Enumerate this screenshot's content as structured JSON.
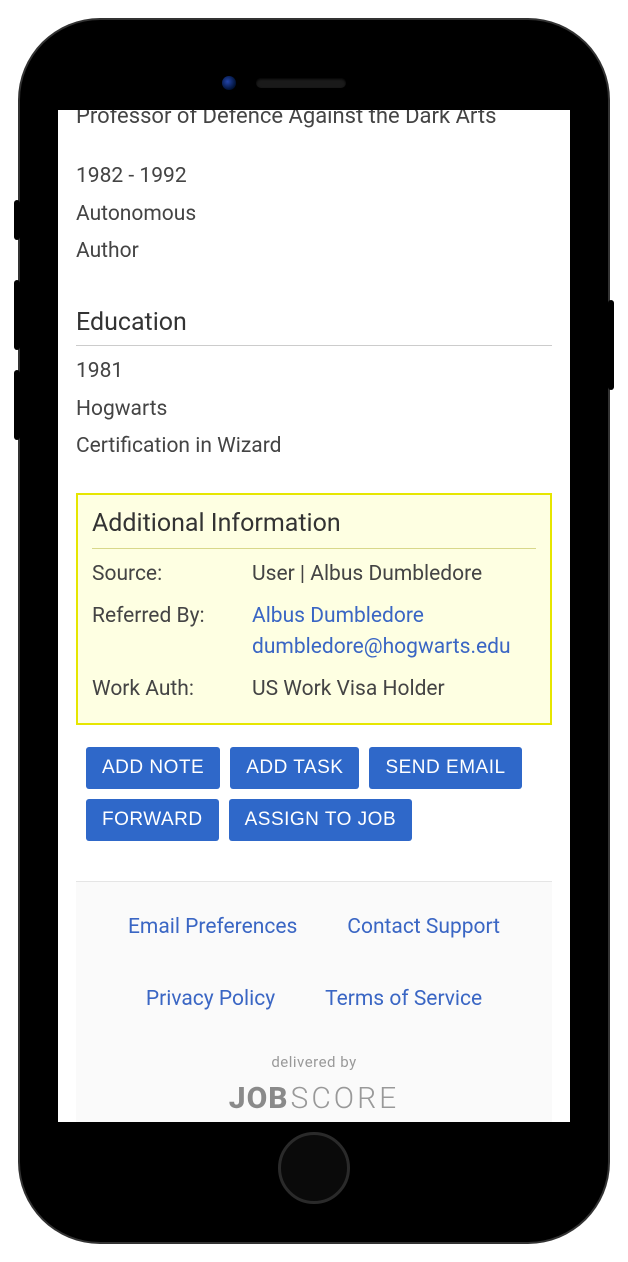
{
  "experience": {
    "title_cut": "Professor of Defence Against the Dark Arts",
    "dates": "1982 - 1992",
    "company": "Autonomous",
    "role": "Author"
  },
  "education": {
    "heading": "Education",
    "year": "1981",
    "school": "Hogwarts",
    "degree": "Certification in Wizard"
  },
  "additional": {
    "heading": "Additional Information",
    "source_label": "Source:",
    "source_value": "User | Albus Dumbledore",
    "referred_label": "Referred By:",
    "referred_name": "Albus Dumbledore",
    "referred_email": "dumbledore@hogwarts.edu",
    "workauth_label": "Work Auth:",
    "workauth_value": "US Work Visa Holder"
  },
  "actions": {
    "add_note": "ADD NOTE",
    "add_task": "ADD TASK",
    "send_email": "SEND EMAIL",
    "forward": "FORWARD",
    "assign_to_job": "ASSIGN TO JOB"
  },
  "footer": {
    "email_prefs": "Email Preferences",
    "contact_support": "Contact Support",
    "privacy_policy": "Privacy Policy",
    "terms_of_service": "Terms of Service",
    "delivered_by": "delivered by",
    "logo_job": "JOB",
    "logo_score": "SCORE"
  }
}
